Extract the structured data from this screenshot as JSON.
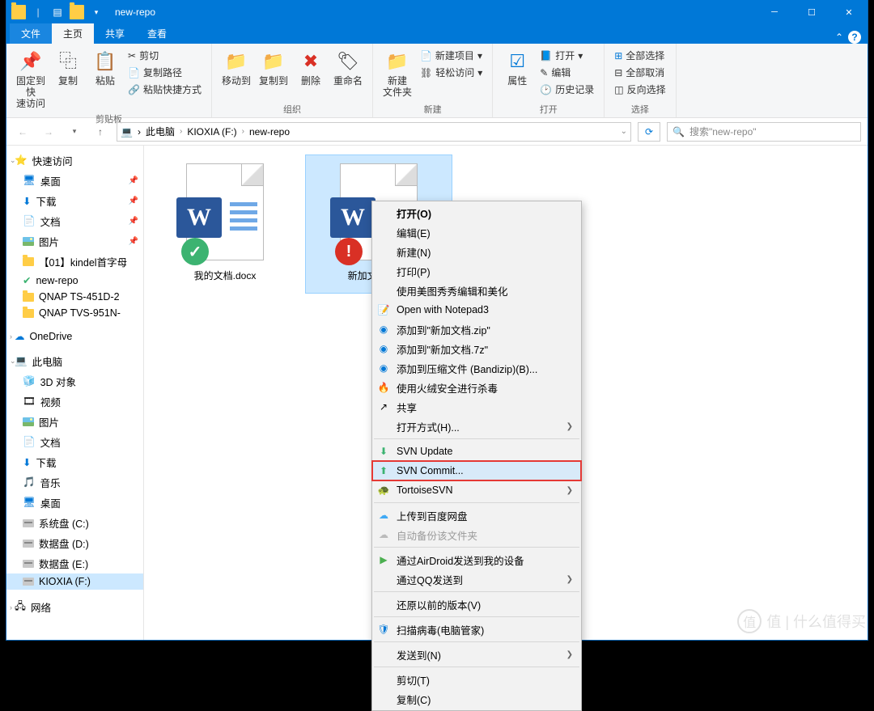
{
  "window": {
    "title": "new-repo"
  },
  "tabs": {
    "file": "文件",
    "home": "主页",
    "share": "共享",
    "view": "查看"
  },
  "ribbon": {
    "clipboard": {
      "label": "剪贴板",
      "pin": "固定到快\n速访问",
      "copy": "复制",
      "paste": "粘贴",
      "cut": "剪切",
      "copypath": "复制路径",
      "pasteshortcut": "粘贴快捷方式"
    },
    "organize": {
      "label": "组织",
      "moveto": "移动到",
      "copyto": "复制到",
      "delete": "删除",
      "rename": "重命名"
    },
    "new": {
      "label": "新建",
      "newfolder": "新建\n文件夹",
      "newitem": "新建项目",
      "easyaccess": "轻松访问"
    },
    "open": {
      "label": "打开",
      "properties": "属性",
      "open": "打开",
      "edit": "编辑",
      "history": "历史记录"
    },
    "select": {
      "label": "选择",
      "all": "全部选择",
      "none": "全部取消",
      "invert": "反向选择"
    }
  },
  "breadcrumb": [
    "此电脑",
    "KIOXIA (F:)",
    "new-repo"
  ],
  "search": {
    "placeholder": "搜索\"new-repo\""
  },
  "sidebar": {
    "quick": {
      "label": "快速访问",
      "items": [
        "桌面",
        "下载",
        "文档",
        "图片",
        "【01】kindel首字母",
        "new-repo",
        "QNAP TS-451D-2",
        "QNAP TVS-951N-"
      ]
    },
    "onedrive": "OneDrive",
    "thispc": {
      "label": "此电脑",
      "items": [
        "3D 对象",
        "视频",
        "图片",
        "文档",
        "下载",
        "音乐",
        "桌面",
        "系统盘 (C:)",
        "数据盘 (D:)",
        "数据盘 (E:)",
        "KIOXIA (F:)"
      ]
    },
    "network": "网络"
  },
  "files": [
    {
      "name": "我的文档.docx",
      "status": "ok"
    },
    {
      "name": "新加文档.docx",
      "status": "err",
      "selected": true
    }
  ],
  "contextmenu": {
    "open": "打开(O)",
    "edit": "编辑(E)",
    "new": "新建(N)",
    "print": "打印(P)",
    "meitu": "使用美图秀秀编辑和美化",
    "notepad3": "Open with Notepad3",
    "zip": "添加到\"新加文档.zip\"",
    "sevenz": "添加到\"新加文档.7z\"",
    "bandizip": "添加到压缩文件 (Bandizip)(B)...",
    "huorong": "使用火绒安全进行杀毒",
    "share": "共享",
    "openwith": "打开方式(H)...",
    "svnupdate": "SVN Update",
    "svncommit": "SVN Commit...",
    "tortoisesvn": "TortoiseSVN",
    "baidu": "上传到百度网盘",
    "autobackup": "自动备份该文件夹",
    "airdroid": "通过AirDroid发送到我的设备",
    "qq": "通过QQ发送到",
    "restore": "还原以前的版本(V)",
    "scan": "扫描病毒(电脑管家)",
    "sendto": "发送到(N)",
    "cut": "剪切(T)",
    "copy": "复制(C)"
  },
  "watermark": "值 | 什么值得买"
}
